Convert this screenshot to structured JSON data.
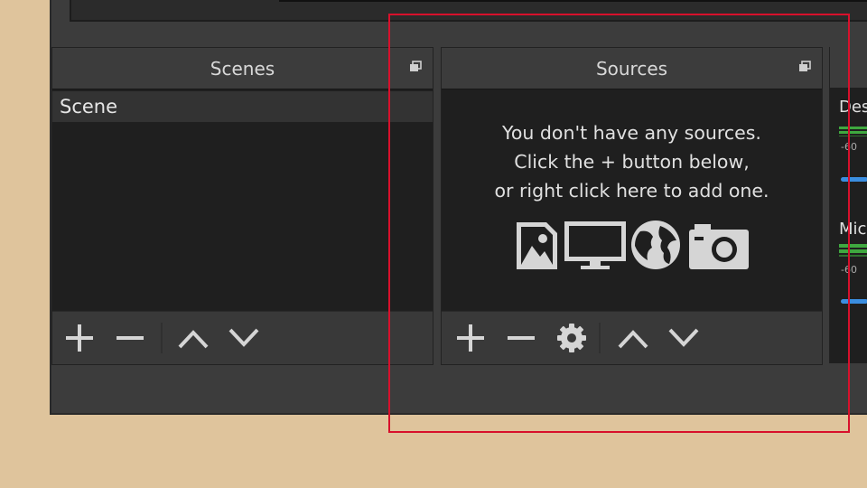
{
  "scenes_dock": {
    "title": "Scenes",
    "items": [
      "Scene"
    ],
    "toolbar": [
      "add",
      "remove",
      "move-up",
      "move-down"
    ]
  },
  "sources_dock": {
    "title": "Sources",
    "empty_message": [
      "You don't have any sources.",
      "Click the + button below,",
      "or right click here to add one."
    ],
    "source_type_icons": [
      "image-icon",
      "display-capture-icon",
      "browser-globe-icon",
      "camera-icon"
    ],
    "toolbar": [
      "add",
      "remove",
      "properties",
      "move-up",
      "move-down"
    ]
  },
  "audio_mixer": {
    "channels": [
      {
        "label": "Des",
        "db_marker": "-60"
      },
      {
        "label": "Mic",
        "db_marker": "-60"
      }
    ]
  },
  "colors": {
    "desktop_background": "#dfc49c",
    "panel": "#3c3c3c",
    "list_background": "#1f1f1f",
    "highlight_box": "#d8102c",
    "fader_accent": "#3b8ee0",
    "meter_green": "#3fa83f"
  }
}
